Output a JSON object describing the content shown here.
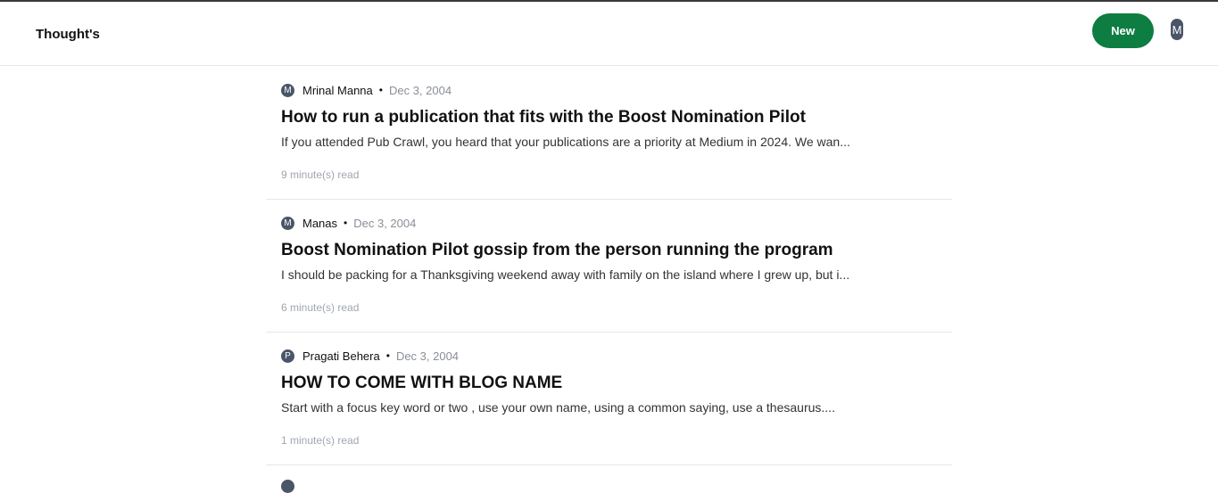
{
  "header": {
    "brand": "Thought's",
    "new_button_label": "New",
    "user_avatar_letter": "M"
  },
  "posts": [
    {
      "author_initial": "M",
      "author": "Mrinal Manna",
      "date": "Dec 3, 2004",
      "title": "How to run a publication that fits with the Boost Nomination Pilot",
      "excerpt": "If you attended Pub Crawl, you heard that your publications are a priority at Medium in 2024. We wan...",
      "read_time": "9 minute(s) read"
    },
    {
      "author_initial": "M",
      "author": "Manas",
      "date": "Dec 3, 2004",
      "title": "Boost Nomination Pilot gossip from the person running the program",
      "excerpt": "I should be packing for a Thanksgiving weekend away with family on the island where I grew up, but i...",
      "read_time": "6 minute(s) read"
    },
    {
      "author_initial": "P",
      "author": "Pragati Behera",
      "date": "Dec 3, 2004",
      "title": "HOW TO COME WITH BLOG NAME",
      "excerpt": "Start with a focus key word or two , use your own name, using a common saying, use a thesaurus....",
      "read_time": "1 minute(s) read"
    }
  ],
  "meta_separator": "•",
  "colors": {
    "accent": "#0d7d41",
    "avatar_bg": "#4a5568",
    "date_text": "#8a8f98",
    "divider": "#e6e6e6"
  }
}
